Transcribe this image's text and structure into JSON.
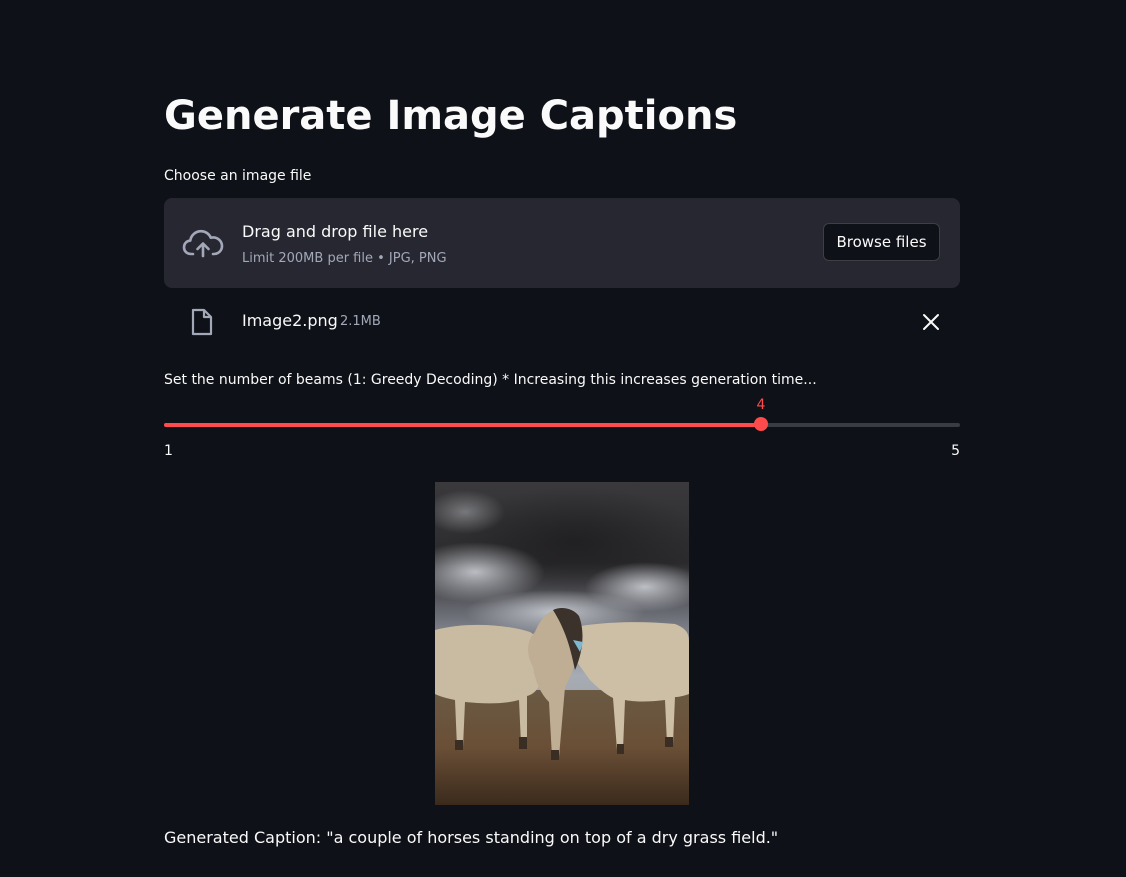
{
  "page": {
    "title": "Generate Image Captions"
  },
  "uploader": {
    "label": "Choose an image file",
    "drop_title": "Drag and drop file here",
    "drop_subtitle": "Limit 200MB per file • JPG, PNG",
    "browse_label": "Browse files"
  },
  "uploaded_file": {
    "name": "Image2.png",
    "size": "2.1MB"
  },
  "slider": {
    "label": "Set the number of beams (1: Greedy Decoding) * Increasing this increases generation time...",
    "min": 1,
    "max": 5,
    "value": 4,
    "min_label": "1",
    "max_label": "5",
    "value_label": "4"
  },
  "result": {
    "caption": "Generated Caption: \"a couple of horses standing on top of a dry grass field.\""
  },
  "colors": {
    "background": "#0e1117",
    "surface": "#262730",
    "accent": "#ff4b4b",
    "text": "#fafafa",
    "muted": "#a3a8b8"
  },
  "icons": {
    "upload": "cloud-upload-icon",
    "file": "file-icon",
    "close": "close-icon"
  }
}
